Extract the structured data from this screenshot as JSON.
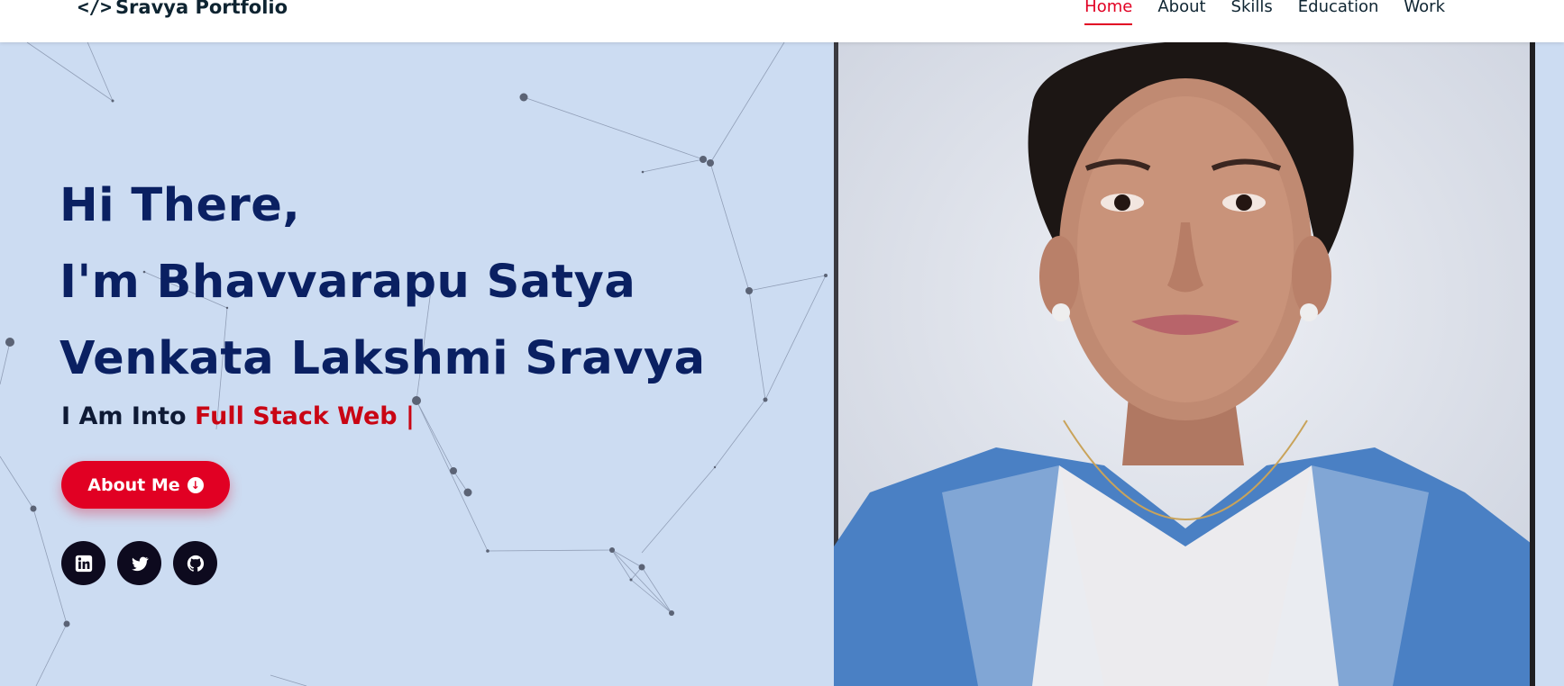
{
  "nav": {
    "brand_icon": "code-icon",
    "brand_code": "</>",
    "brand_text": "Sravya Portfolio",
    "links": [
      {
        "label": "Home",
        "active": true
      },
      {
        "label": "About",
        "active": false
      },
      {
        "label": "Skills",
        "active": false
      },
      {
        "label": "Education",
        "active": false
      },
      {
        "label": "Work",
        "active": false
      }
    ]
  },
  "hero": {
    "greeting": "Hi There,",
    "name_line1": "I'm Bhavvarapu Satya",
    "name_line2": "Venkata Lakshmi Sravya",
    "intro_prefix": "I Am Into",
    "intro_highlight": "Full Stack Web |",
    "about_button": "About Me",
    "about_button_icon": "arrow-down-circle-icon",
    "socials": [
      {
        "icon": "linkedin-icon"
      },
      {
        "icon": "twitter-icon"
      },
      {
        "icon": "github-icon"
      }
    ]
  },
  "colors": {
    "accent": "#e10023",
    "heading": "#0a2062",
    "background": "#ccdcf2"
  }
}
